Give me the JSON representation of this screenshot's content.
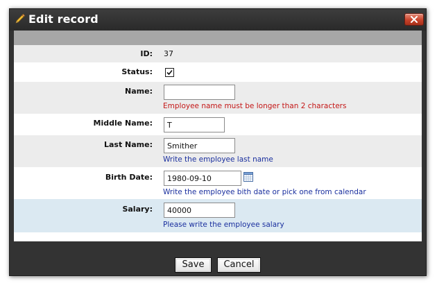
{
  "dialog": {
    "title": "Edit record",
    "title_icon": "pencil-icon",
    "close_icon": "close-icon"
  },
  "form": {
    "id": {
      "label": "ID:",
      "value": "37"
    },
    "status": {
      "label": "Status:",
      "checked": true
    },
    "name": {
      "label": "Name:",
      "value": "",
      "error": "Employee name must be longer than 2 characters"
    },
    "middle_name": {
      "label": "Middle Name:",
      "value": "T"
    },
    "last_name": {
      "label": "Last Name:",
      "value": "Smither",
      "hint": "Write the employee last name"
    },
    "birth_date": {
      "label": "Birth Date:",
      "value": "1980-09-10",
      "hint": "Write the employee bith date or pick one from calendar",
      "icon": "calendar-icon"
    },
    "salary": {
      "label": "Salary:",
      "value": "40000",
      "hint": "Please write the employee salary"
    }
  },
  "buttons": {
    "save": "Save",
    "cancel": "Cancel"
  },
  "colors": {
    "dialog_bg": "#333333",
    "row_alt": "#ececec",
    "row_active": "#dbe9f2",
    "hint_blue": "#1a2f9e",
    "error_red": "#c41717",
    "close_red": "#c9432b"
  }
}
